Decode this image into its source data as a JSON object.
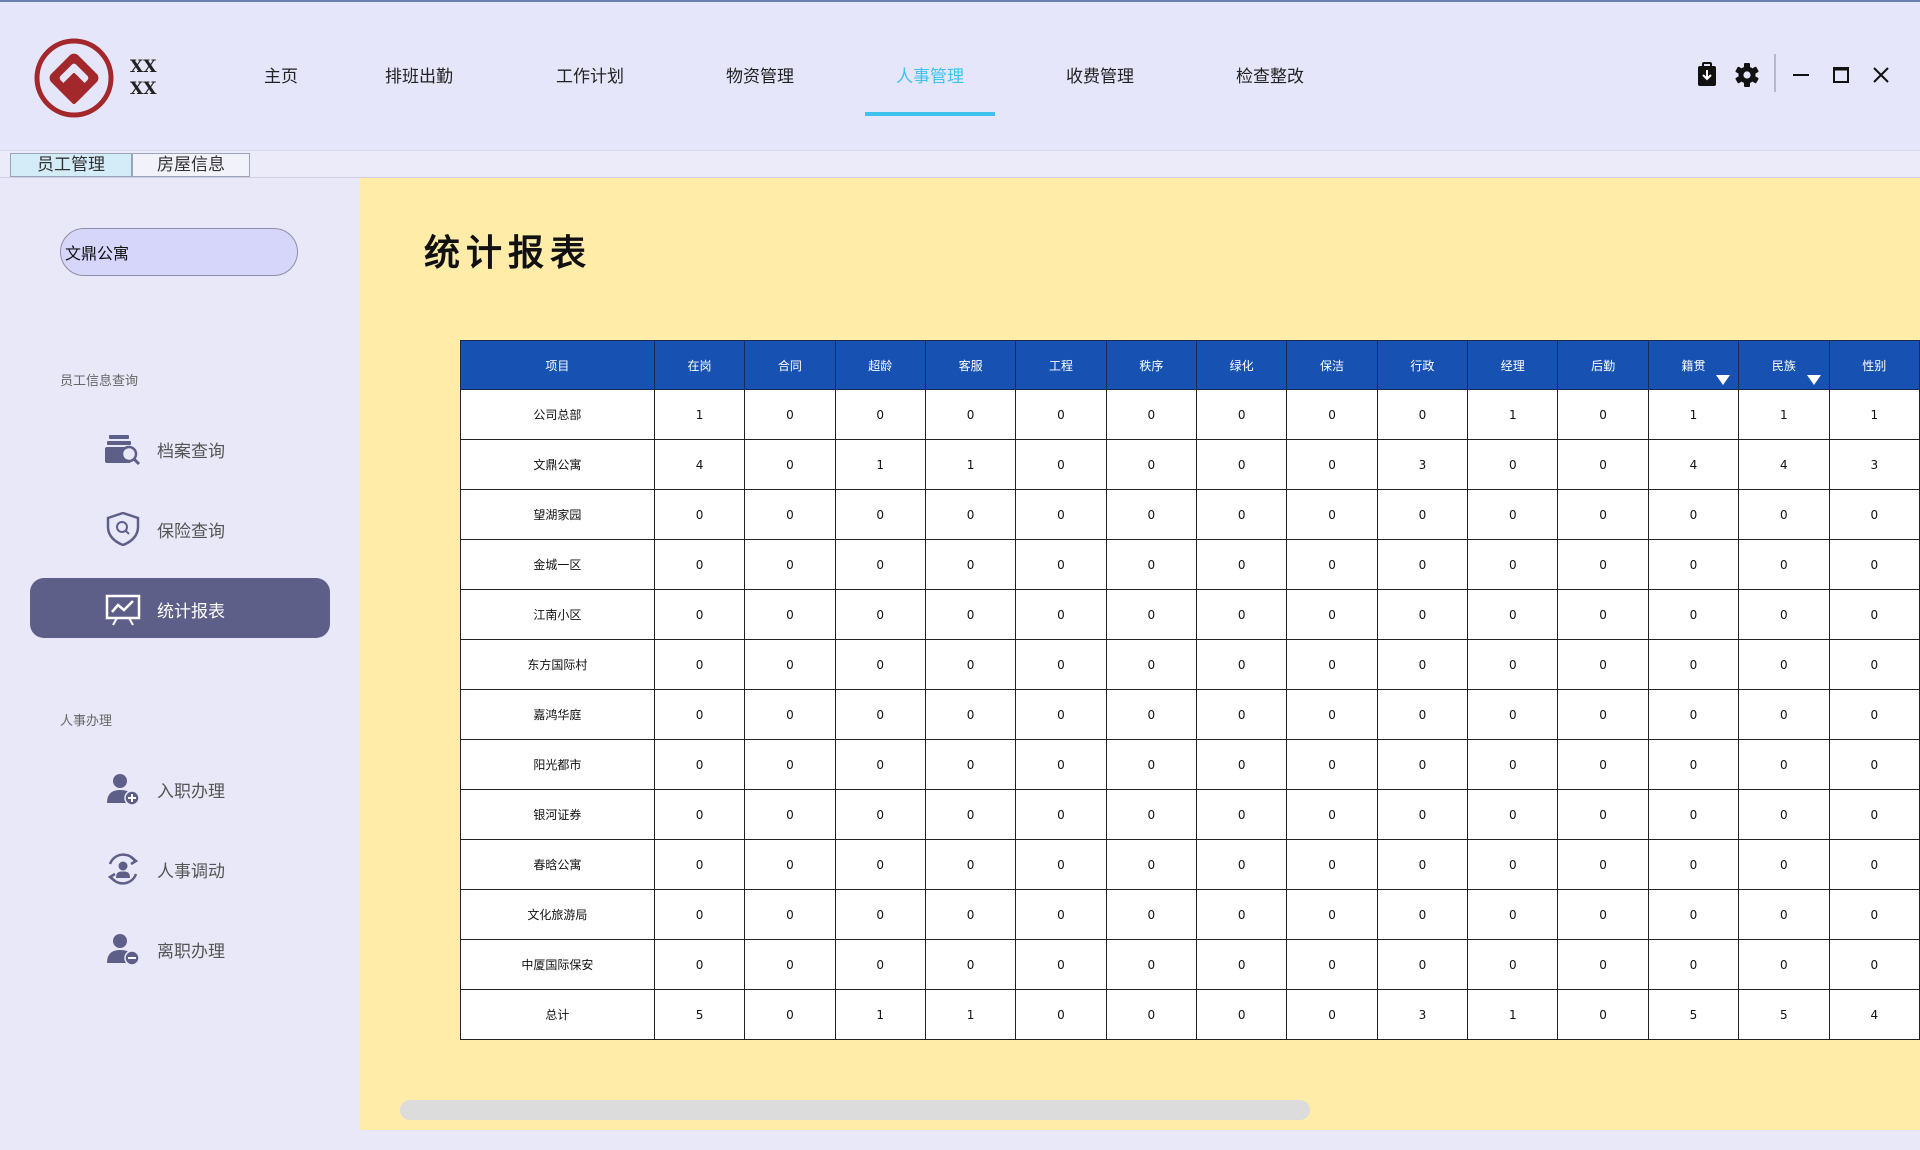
{
  "header": {
    "logo_text_line1": "XX",
    "logo_text_line2": "XX",
    "nav": [
      {
        "label": "主页"
      },
      {
        "label": "排班出勤"
      },
      {
        "label": "工作计划"
      },
      {
        "label": "物资管理"
      },
      {
        "label": "人事管理",
        "active": true
      },
      {
        "label": "收费管理"
      },
      {
        "label": "检查整改"
      }
    ],
    "icons": [
      "download-icon",
      "gear-icon",
      "minimize-icon",
      "maximize-icon",
      "close-icon"
    ]
  },
  "subtabs": [
    {
      "label": "员工管理",
      "active": true
    },
    {
      "label": "房屋信息"
    }
  ],
  "sidebar": {
    "search_value": "文鼎公寓",
    "section1_label": "员工信息查询",
    "section2_label": "人事办理",
    "items": [
      {
        "label": "档案查询",
        "icon": "archive-search-icon"
      },
      {
        "label": "保险查询",
        "icon": "shield-search-icon"
      },
      {
        "label": "统计报表",
        "icon": "chart-board-icon",
        "active": true
      },
      {
        "label": "入职办理",
        "icon": "user-add-icon"
      },
      {
        "label": "人事调动",
        "icon": "user-transfer-icon"
      },
      {
        "label": "离职办理",
        "icon": "user-remove-icon"
      }
    ]
  },
  "main": {
    "title": "统计报表",
    "table": {
      "headers": [
        "项目",
        "在岗",
        "合同",
        "超龄",
        "客服",
        "工程",
        "秩序",
        "绿化",
        "保洁",
        "行政",
        "经理",
        "后勤",
        "籍贯",
        "民族",
        "性别"
      ],
      "filter_columns": [
        "籍贯",
        "民族"
      ],
      "rows": [
        [
          "公司总部",
          "1",
          "0",
          "0",
          "0",
          "0",
          "0",
          "0",
          "0",
          "0",
          "1",
          "0",
          "1",
          "1",
          "1"
        ],
        [
          "文鼎公寓",
          "4",
          "0",
          "1",
          "1",
          "0",
          "0",
          "0",
          "0",
          "3",
          "0",
          "0",
          "4",
          "4",
          "3"
        ],
        [
          "望湖家园",
          "0",
          "0",
          "0",
          "0",
          "0",
          "0",
          "0",
          "0",
          "0",
          "0",
          "0",
          "0",
          "0",
          "0"
        ],
        [
          "金城一区",
          "0",
          "0",
          "0",
          "0",
          "0",
          "0",
          "0",
          "0",
          "0",
          "0",
          "0",
          "0",
          "0",
          "0"
        ],
        [
          "江南小区",
          "0",
          "0",
          "0",
          "0",
          "0",
          "0",
          "0",
          "0",
          "0",
          "0",
          "0",
          "0",
          "0",
          "0"
        ],
        [
          "东方国际村",
          "0",
          "0",
          "0",
          "0",
          "0",
          "0",
          "0",
          "0",
          "0",
          "0",
          "0",
          "0",
          "0",
          "0"
        ],
        [
          "嘉鸿华庭",
          "0",
          "0",
          "0",
          "0",
          "0",
          "0",
          "0",
          "0",
          "0",
          "0",
          "0",
          "0",
          "0",
          "0"
        ],
        [
          "阳光都市",
          "0",
          "0",
          "0",
          "0",
          "0",
          "0",
          "0",
          "0",
          "0",
          "0",
          "0",
          "0",
          "0",
          "0"
        ],
        [
          "银河证券",
          "0",
          "0",
          "0",
          "0",
          "0",
          "0",
          "0",
          "0",
          "0",
          "0",
          "0",
          "0",
          "0",
          "0"
        ],
        [
          "春晗公寓",
          "0",
          "0",
          "0",
          "0",
          "0",
          "0",
          "0",
          "0",
          "0",
          "0",
          "0",
          "0",
          "0",
          "0"
        ],
        [
          "文化旅游局",
          "0",
          "0",
          "0",
          "0",
          "0",
          "0",
          "0",
          "0",
          "0",
          "0",
          "0",
          "0",
          "0",
          "0"
        ],
        [
          "中厦国际保安",
          "0",
          "0",
          "0",
          "0",
          "0",
          "0",
          "0",
          "0",
          "0",
          "0",
          "0",
          "0",
          "0",
          "0"
        ],
        [
          "总计",
          "5",
          "0",
          "1",
          "1",
          "0",
          "0",
          "0",
          "0",
          "3",
          "1",
          "0",
          "5",
          "5",
          "4"
        ]
      ]
    }
  },
  "colors": {
    "header_bg": "#e6e6fa",
    "accent": "#3dc3ee",
    "table_header": "#1752b3",
    "content_bg": "#ffeca8",
    "sidebar_active": "#5e5f88",
    "logo": "#a3282b"
  }
}
